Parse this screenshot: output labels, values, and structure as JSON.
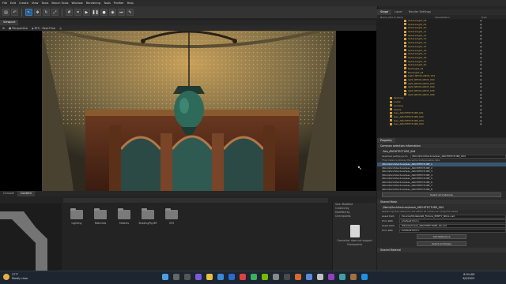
{
  "menu": [
    "File",
    "Edit",
    "Create",
    "View",
    "Tools",
    "Bench Tools",
    "Window",
    "Rendering",
    "Tools",
    "Profiler",
    "Help"
  ],
  "toolbar_icons": [
    "folder-icon",
    "undo-icon",
    "move-icon",
    "rotate-icon",
    "scale-icon",
    "select-icon",
    "grid-icon",
    "snap-icon",
    "play-icon",
    "pause-icon",
    "step-icon",
    "record-icon",
    "camera-icon"
  ],
  "viewport": {
    "tab": "Viewport",
    "toolbar": [
      "Perspective",
      "RTX - Real-Time"
    ]
  },
  "bottom": {
    "tabs": [
      "Console",
      "Content"
    ],
    "folders": [
      "Lighting",
      "Materials",
      "Meshes",
      "ShadingPlg BR",
      "VFX"
    ],
    "info": [
      "Size: Modified",
      "Created by",
      "Modified by",
      "Checkpoints"
    ],
    "checkpoint_note": "Connector does not support Checkpoints"
  },
  "right": {
    "tabs": [
      "Stage",
      "Layer",
      "Render Settings"
    ],
    "outliner_header": [
      "Name (Old to New)",
      "Visualization",
      "Type"
    ],
    "outliner_rows": [
      "SphereLight_08",
      "SphereLight_09",
      "SphereLight_10",
      "SphereLight_11",
      "SphereLight_12",
      "SphereLight_13",
      "SphereLight_14",
      "SphereLight_15",
      "SphereLight_16",
      "SphereLight_17",
      "SphereLight_18",
      "SphereLight_19",
      "SphereLight_20",
      "RectLight_01",
      "RectLight_02",
      "Light_NECKLANCE_001",
      "light_NECKLANCE_002",
      "light_NECKLANCE_003",
      "light_NECKLANCE_004",
      "light_NECKLANCE_005",
      "light_NECKLANCE_006",
      "Textures",
      "Looks",
      "Anchors",
      "Chairs",
      "Geo_ARCHITECTURE_001",
      "Geo_ARCHITECTURE_002",
      "Geo_ARCHITECTURE_003",
      "Geo_ARCHITECTURE_004"
    ],
    "props_header": "Property",
    "section_common": "Common selection information",
    "section_path": "Geo_ARCHITECTURE_004",
    "path_label": "Selected path(s) prim",
    "path_value": "/World/Architecture/Geo_ARCHITECTURE_004",
    "instance_note": "This instance shares the same instanceable data",
    "instance_list": [
      "/World/Architecture/Geo_ARCHITECTURE_1",
      "/World/Architecture/Geo_ARCHITECTURE_2",
      "/World/Architecture/Geo_ARCHITECTURE_3",
      "/World/Architecture/Geo_ARCHITECTURE_4",
      "/World/Architecture/Geo_ARCHITECTURE_5",
      "/World/Architecture/Geo_ARCHITECTURE_6",
      "/World/Architecture/Geo_ARCHITECTURE_7",
      "/World/Architecture/Geo_ARCHITECTURE_8"
    ],
    "select_all": "Select all instances",
    "section_mesh": "Shared Mesh",
    "section_ref": "/World/Architecture/mesh_ARCHITECTURE_004",
    "ref_note": "Replacing this reference will affect all instances using this asset",
    "asset_label": "Asset Path",
    "asset_value1": "./Source/Models/GR_Fixture_EMPTY_NULL.usd",
    "prim_label": "Prim Path",
    "prim_value": "<Default Prim>",
    "asset_value2": "./Models/mesh_ARCHITECTURE_04.usd",
    "add_ref": "Add Reference",
    "select_prototype": "Select prototype",
    "section_material": "Shared Material"
  },
  "taskbar": {
    "weather_temp": "27°F",
    "weather_desc": "Mostly clear",
    "time": "8:04 AM",
    "date": "3/9/2022"
  }
}
